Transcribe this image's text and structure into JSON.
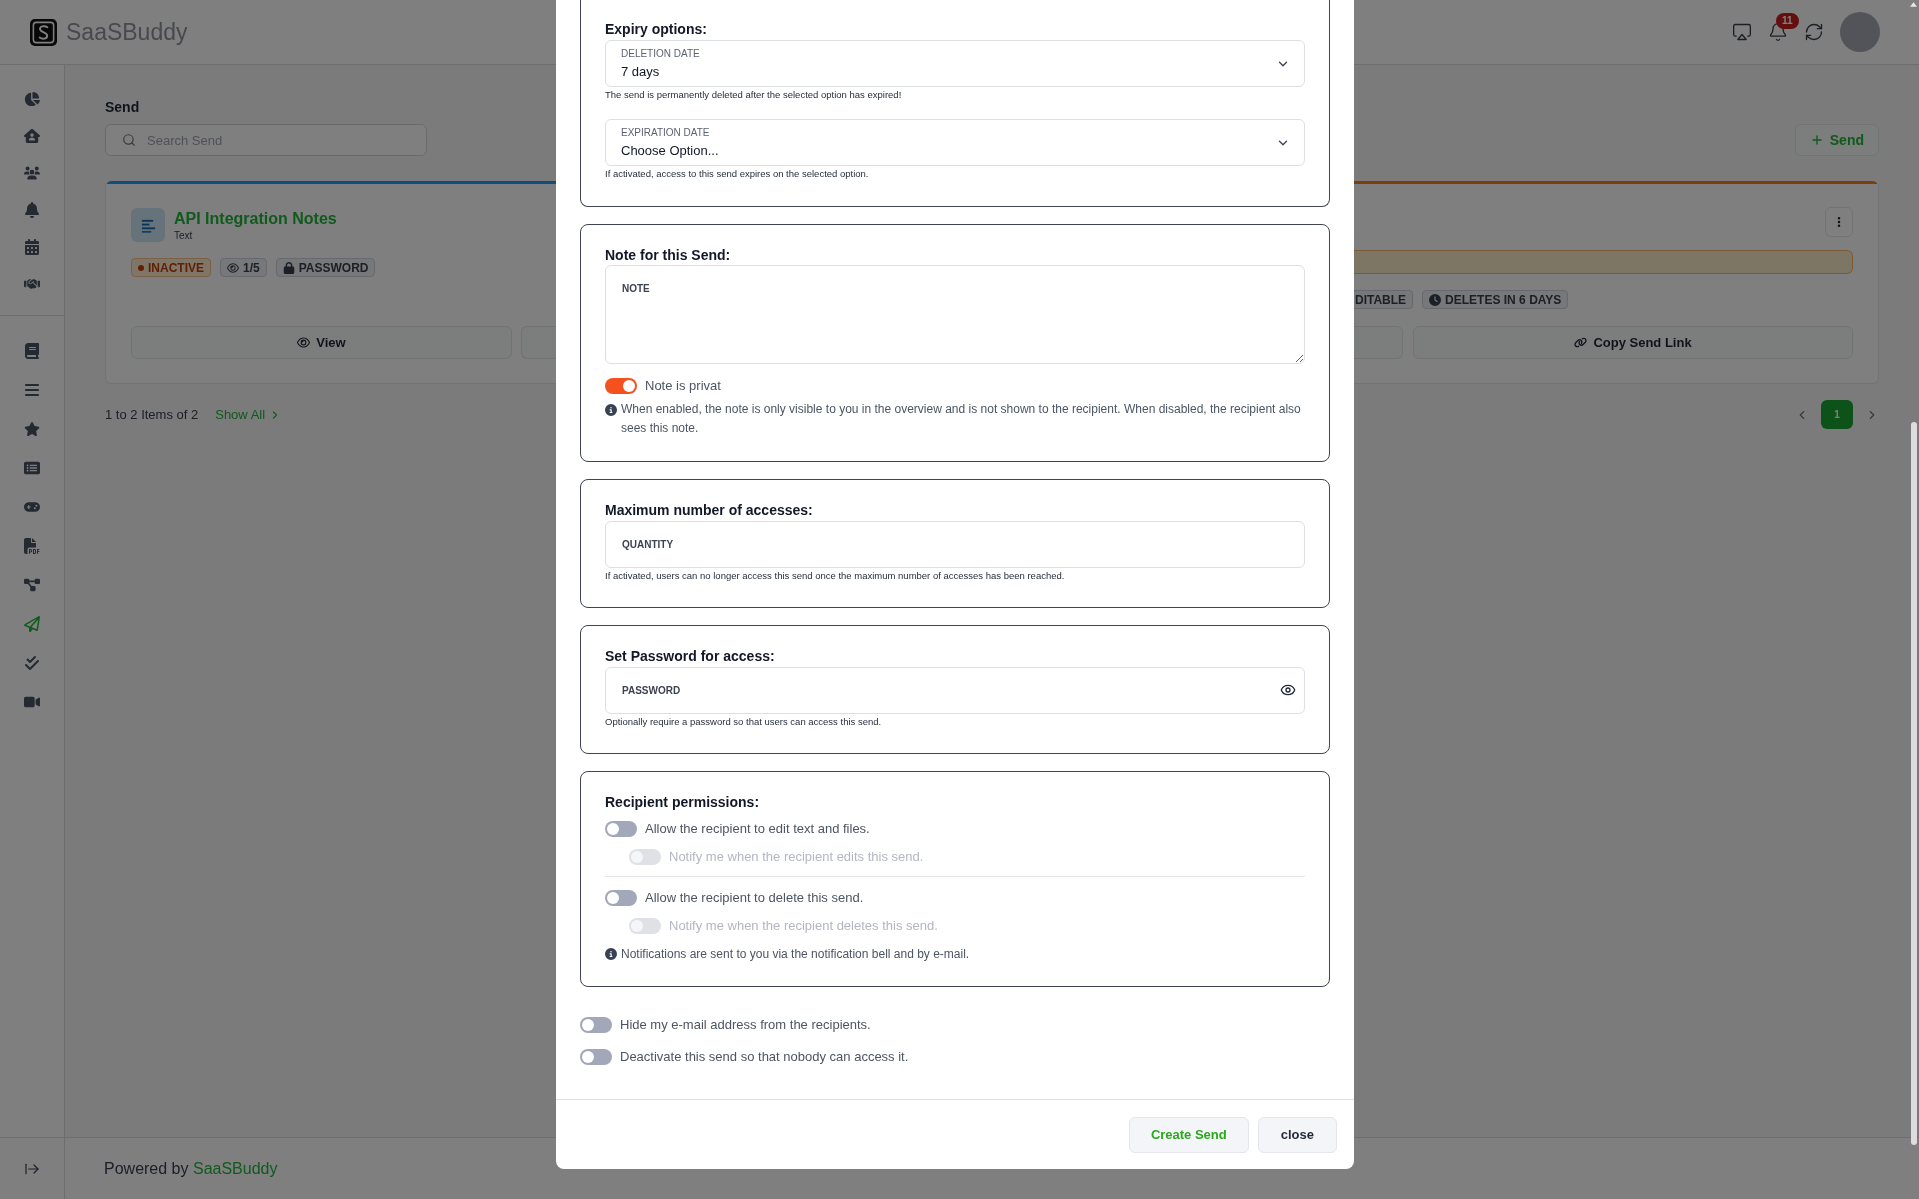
{
  "header": {
    "brand": "SaaSBuddy",
    "notifications": "11"
  },
  "sidebar": {
    "groups": [
      {
        "items": [
          {
            "selected": false
          },
          {
            "selected": false
          },
          {
            "selected": false
          },
          {
            "selected": false
          },
          {
            "selected": false
          },
          {
            "selected": false
          }
        ]
      },
      {
        "items": [
          {
            "selected": false
          },
          {
            "selected": false
          },
          {
            "selected": false
          },
          {
            "selected": false
          },
          {
            "selected": false
          },
          {
            "selected": false
          },
          {
            "selected": false
          },
          {
            "selected": true
          },
          {
            "selected": false
          },
          {
            "selected": false
          }
        ]
      }
    ]
  },
  "page": {
    "title": "Send",
    "search": {
      "placeholder": "Search Send"
    },
    "add_button": "Send",
    "cards": [
      {
        "title": "API Integration Notes",
        "type": "Text",
        "color": "#0e4f7e",
        "warning": false,
        "badges": [
          {
            "kind": "status",
            "label": "INACTIVE"
          },
          {
            "kind": "views",
            "label": "1/5"
          },
          {
            "kind": "password",
            "label": "PASSWORD"
          }
        ],
        "actions": [
          {
            "kind": "view",
            "label": "View"
          }
        ]
      },
      {
        "color": "#7a3f0c",
        "warning": true,
        "badges": [
          {
            "kind": "editable",
            "label": "DITABLE"
          },
          {
            "kind": "deletes",
            "label": "DELETES IN 6 DAYS"
          }
        ],
        "actions": [
          {
            "kind": "copy_link",
            "label": "Copy Send Link"
          }
        ]
      }
    ],
    "pagination": {
      "summary": "1 to 2 Items of 2",
      "show_all": "Show All",
      "pages": [
        {
          "label": "1",
          "selected": true
        }
      ]
    }
  },
  "modal": {
    "sections": [
      {
        "kind": "expiry",
        "title": "Expiry options:",
        "selects": [
          {
            "label": "DELETION DATE",
            "value": "7 days",
            "help": "The send is permanently deleted after the selected option has expired!"
          },
          {
            "label": "EXPIRATION DATE",
            "value": "Choose Option...",
            "help": "If activated, access to this send expires on the selected option."
          }
        ]
      },
      {
        "kind": "note",
        "title": "Note for this Send:",
        "field": {
          "placeholder": "NOTE"
        },
        "toggle": {
          "label": "Note is privat",
          "on": true
        },
        "info": "When enabled, the note is only visible to you in the overview and is not shown to the recipient. When disabled, the recipient also sees this note."
      },
      {
        "kind": "quantity",
        "title": "Maximum number of accesses:",
        "field": {
          "placeholder": "QUANTITY"
        },
        "help": "If activated, users can no longer access this send once the maximum number of accesses has been reached."
      },
      {
        "kind": "password",
        "title": "Set Password for access:",
        "field": {
          "placeholder": "PASSWORD"
        },
        "help": "Optionally require a password so that users can access this send."
      },
      {
        "kind": "permissions",
        "title": "Recipient permissions:",
        "groups": [
          {
            "label": "Allow the recipient to edit text and files.",
            "on": false,
            "notify": {
              "label": "Notify me when the recipient edits this send.",
              "on": false,
              "disabled": true
            }
          },
          {
            "label": "Allow the recipient to delete this send.",
            "on": false,
            "notify": {
              "label": "Notify me when the recipient deletes this send.",
              "on": false,
              "disabled": true
            }
          }
        ],
        "info": "Notifications are sent to you via the notification bell and by e-mail."
      }
    ],
    "options": [
      {
        "label": "Hide my e-mail address from the recipients.",
        "on": false
      },
      {
        "label": "Deactivate this send so that nobody can access it.",
        "on": false
      }
    ],
    "buttons": [
      {
        "kind": "primary",
        "label": "Create Send"
      },
      {
        "kind": "secondary",
        "label": "close"
      }
    ]
  },
  "footer": {
    "text": "Powered by",
    "link": "SaaSBuddy"
  }
}
